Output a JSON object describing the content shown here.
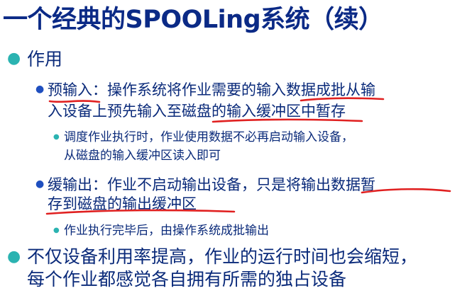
{
  "title": "一个经典的SPOOLing系统（续）",
  "sections": [
    {
      "heading": "作用",
      "items": [
        {
          "text_line1": "预输入：操作系统将作业需要的输入数据成批从输",
          "text_line2": "入设备上预先输入至磁盘的输入缓冲区中暂存",
          "sub": {
            "line1": "调度作业执行时，作业使用数据不必再启动输入设备，",
            "line2": "从磁盘的输入缓冲区读入即可"
          }
        },
        {
          "text_line1": "缓输出：作业不启动输出设备，只是将输出数据暂",
          "text_line2": "存到磁盘的输出缓冲区",
          "sub": {
            "line1": "作业执行完毕后，由操作系统成批输出"
          }
        }
      ]
    }
  ],
  "conclusion": {
    "line1": "不仅设备利用率提高，作业的运行时间也会缩短，",
    "line2": "每个作业都感觉各自拥有所需的独占设备"
  },
  "colors": {
    "text": "#0a2a7a",
    "bullet_level1": "#2bb3b1",
    "bullet_level2": "#1f4fbf",
    "annotation_red": "#e02020"
  }
}
